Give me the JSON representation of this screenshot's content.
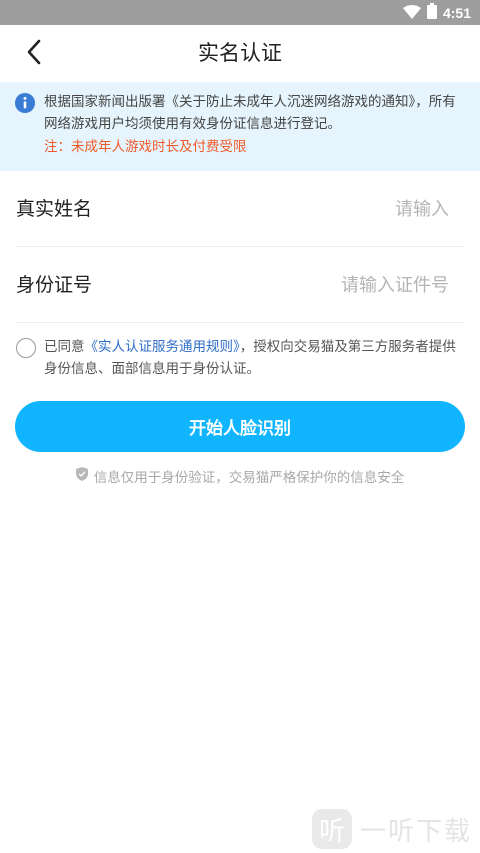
{
  "status_bar": {
    "time": "4:51"
  },
  "nav": {
    "title": "实名认证"
  },
  "notice": {
    "text": "根据国家新闻出版署《关于防止未成年人沉迷网络游戏的通知》，所有网络游戏用户均须使用有效身份证信息进行登记。",
    "warning": "注：未成年人游戏时长及付费受限"
  },
  "form": {
    "name_label": "真实姓名",
    "name_placeholder": "请输入",
    "name_value": "",
    "id_label": "身份证号",
    "id_placeholder": "请输入证件号",
    "id_value": ""
  },
  "agreement": {
    "prefix": "已同意",
    "link": "《实人认证服务通用规则》",
    "suffix": "，授权向交易猫及第三方服务者提供身份信息、面部信息用于身份认证。",
    "checked": false
  },
  "actions": {
    "start_face_recognition": "开始人脸识别"
  },
  "safety_note": "信息仅用于身份验证，交易猫严格保护你的信息安全",
  "watermark": {
    "logo": "听",
    "text": "一听下载"
  },
  "colors": {
    "primary": "#10b4ff",
    "notice_bg": "#e6f5fd",
    "warning": "#f05a2a",
    "link": "#2f6ec8",
    "info_icon": "#3a7bd5"
  }
}
